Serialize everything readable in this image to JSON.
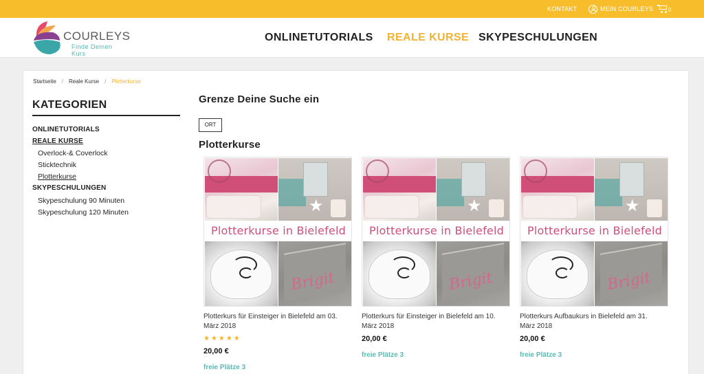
{
  "topbar": {
    "kontakt": "KONTAKT",
    "account": "MEIN COURLEYS",
    "cart_count": "0"
  },
  "brand": {
    "name": "COURLEYS",
    "tagline": "Finde Deinen Kurs",
    "colors": {
      "accent": "#f7bd2a",
      "teal": "#5bbab4",
      "pink": "#cf4f79"
    }
  },
  "nav": {
    "items": [
      "ONLINETUTORIALS",
      "REALE KURSE",
      "SKYPESCHULUNGEN"
    ],
    "active": "REALE KURSE"
  },
  "breadcrumb": [
    "Startseite",
    "Reale Kurse",
    "Plotterkurse"
  ],
  "sidebar": {
    "title": "KATEGORIEN",
    "items": [
      {
        "label": "ONLINETUTORIALS",
        "level": 0
      },
      {
        "label": "REALE KURSE",
        "level": 0
      },
      {
        "label": "Overlock-& Coverlock",
        "level": 1
      },
      {
        "label": "Sticktechnik",
        "level": 1
      },
      {
        "label": "Plotterkurse",
        "level": 1
      },
      {
        "label": "SKYPESCHULUNGEN",
        "level": 0
      },
      {
        "label": "Skypeschulung 90 Minuten",
        "level": 1
      },
      {
        "label": "Skypeschulung 120 Minuten",
        "level": 1
      }
    ]
  },
  "filter": {
    "title": "Grenze Deine Suche ein",
    "ort_label": "ORT"
  },
  "section": {
    "title": "Plotterkurse"
  },
  "products": [
    {
      "image_banner": "Plotterkurse in Bielefeld",
      "image_text": "Brigit",
      "title_line1": "Plotterkurs für Einsteiger in Bielefeld am 03.",
      "title_line2": "März 2018",
      "rating_stars": "★★★★★",
      "price": "20,00 €",
      "free": "freie Plätze 3"
    },
    {
      "image_banner": "Plotterkurse in Bielefeld",
      "image_text": "Brigit",
      "title_line1": "Plotterkurs für Einsteiger in Bielefeld am 10.",
      "title_line2": "März 2018",
      "price": "20,00 €",
      "free": "freie Plätze 3"
    },
    {
      "image_banner": "Plotterkurse in Bielefeld",
      "image_text": "Brigit",
      "title_line1": "Plotterkurs Aufbaukurs in Bielefeld am 31.",
      "title_line2": "März 2018",
      "price": "20,00 €",
      "free": "freie Plätze 3"
    }
  ]
}
